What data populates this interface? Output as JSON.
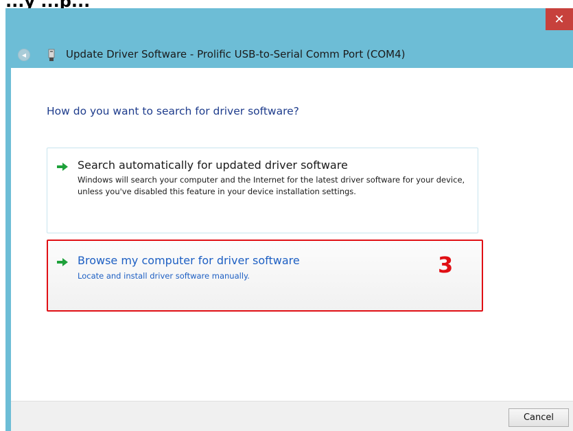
{
  "header": {
    "caption": "...y ...p..."
  },
  "window": {
    "title": "Update Driver Software - Prolific USB-to-Serial Comm Port (COM4)",
    "close_icon": "close-icon",
    "back_icon": "back-arrow-icon",
    "title_icon": "usb-device-icon"
  },
  "main": {
    "heading": "How do you want to search for driver software?",
    "options": [
      {
        "title": "Search automatically for updated driver software",
        "description": "Windows will search your computer and the Internet for the latest driver software for your device, unless you've disabled this feature in your device installation settings.",
        "icon": "green-arrow-icon"
      },
      {
        "title": "Browse my computer for driver software",
        "description": "Locate and install driver software manually.",
        "icon": "green-arrow-icon"
      }
    ],
    "step_number": "3"
  },
  "footer": {
    "cancel_label": "Cancel"
  },
  "colors": {
    "titlebar_bg": "#6dbdd6",
    "close_bg": "#c7413c",
    "heading_text": "#1e3c8c",
    "link_text": "#1d5fc3",
    "highlight_border": "#e00f14",
    "arrow_green": "#1ea13a"
  }
}
